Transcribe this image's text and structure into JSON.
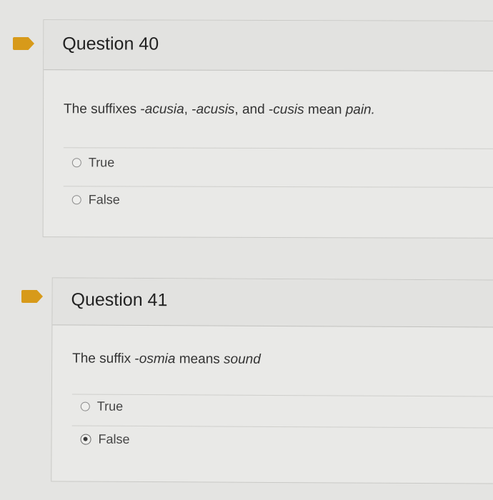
{
  "questions": [
    {
      "title": "Question 40",
      "text_parts": {
        "prefix": "The suffixes -",
        "term1": "acusia",
        "sep1": ", -",
        "term2": "acusis",
        "sep2": ", and -",
        "term3": "cusis",
        "middle": " mean ",
        "term4": "pain.",
        "suffix": ""
      },
      "options": [
        {
          "label": "True",
          "selected": false
        },
        {
          "label": "False",
          "selected": false
        }
      ]
    },
    {
      "title": "Question 41",
      "text_parts": {
        "prefix": "The suffix -",
        "term1": "osmia",
        "middle": " means ",
        "term2": "sound"
      },
      "options": [
        {
          "label": "True",
          "selected": false
        },
        {
          "label": "False",
          "selected": true
        }
      ]
    }
  ],
  "colors": {
    "bookmark": "#d79a1a",
    "background": "#e4e4e2"
  },
  "icons": [
    "bookmark-flag-icon",
    "radio-unchecked-icon",
    "radio-checked-icon"
  ]
}
